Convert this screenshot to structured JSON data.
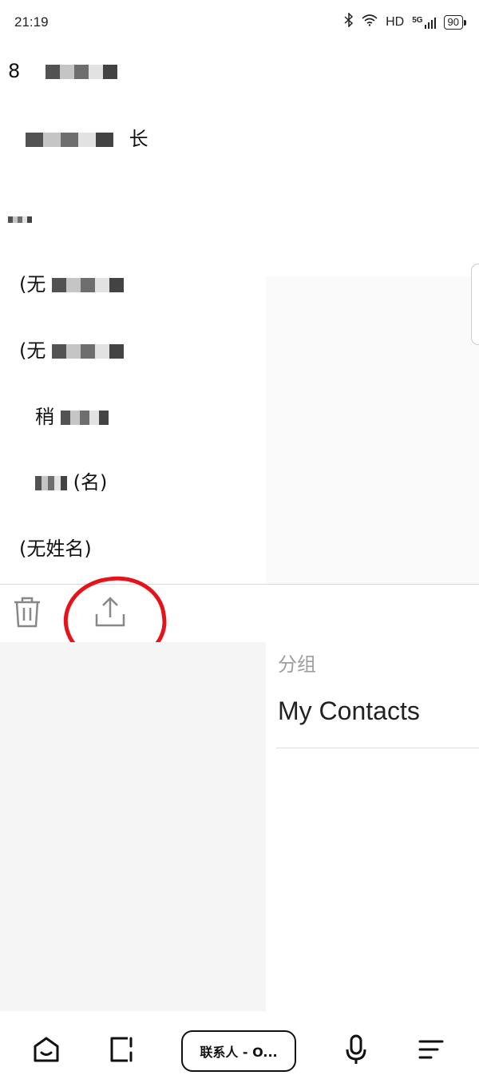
{
  "status_bar": {
    "time": "21:19",
    "network_type": "HD",
    "cellular": "5G",
    "battery_level": "90"
  },
  "contacts": [
    {
      "label": "8"
    },
    {
      "label": "长"
    },
    {
      "label": ""
    },
    {
      "label": "(无"
    },
    {
      "label": "(无"
    },
    {
      "label": "稍"
    },
    {
      "label": "(名)"
    },
    {
      "label": "(无姓名)"
    }
  ],
  "toolbar": {
    "delete_icon": "trash-icon",
    "share_icon": "share-upload-icon",
    "annotation_color": "#e6141a"
  },
  "details": {
    "group_label": "分组",
    "group_value": "My Contacts"
  },
  "nav": {
    "home_icon": "home-icon",
    "window_icon": "window-icon",
    "app_pill": "联系人 - O...",
    "mic_icon": "microphone-icon",
    "menu_icon": "menu-icon"
  }
}
